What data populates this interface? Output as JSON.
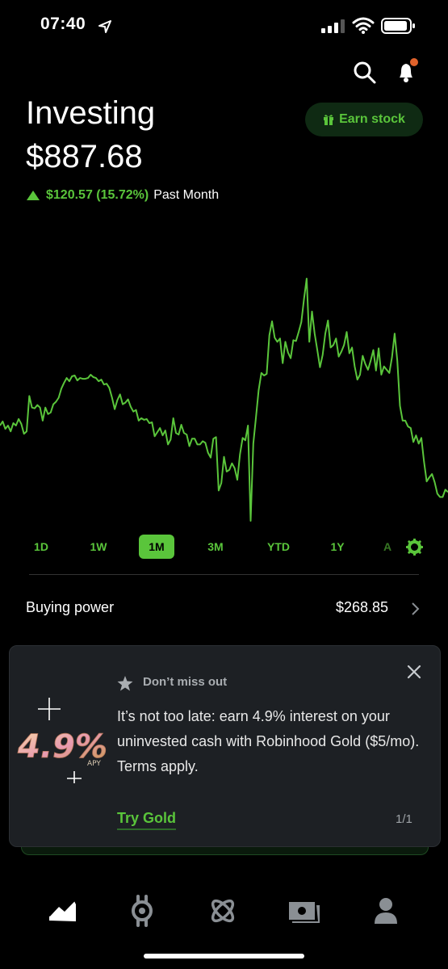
{
  "status_bar": {
    "time": "07:40"
  },
  "header": {
    "title": "Investing",
    "portfolio_value": "$887.68",
    "change_amount": "$120.57 (15.72%)",
    "change_period": "Past Month",
    "earn_stock_label": "Earn stock"
  },
  "colors": {
    "accent": "#5ac53b",
    "background": "#000000",
    "card": "#1d2024"
  },
  "chart_data": {
    "type": "line",
    "series": [
      {
        "values": [
          462,
          467,
          458,
          462,
          455,
          465,
          462,
          470,
          464,
          452,
          455,
          498,
          484,
          483,
          487,
          484,
          468,
          484,
          476,
          478,
          488,
          491,
          496,
          507,
          514,
          520,
          516,
          522,
          523,
          517,
          520,
          519,
          519,
          520,
          524,
          521,
          520,
          516,
          518,
          512,
          513,
          508,
          496,
          482,
          493,
          500,
          488,
          490,
          494,
          485,
          479,
          481,
          468,
          471,
          469,
          470,
          465,
          466,
          449,
          454,
          459,
          450,
          456,
          439,
          445,
          471,
          453,
          451,
          463,
          453,
          451,
          437,
          446,
          446,
          439,
          439,
          443,
          441,
          429,
          423,
          446,
          448,
          383,
          392,
          424,
          406,
          408,
          416,
          410,
          396,
          427,
          447,
          444,
          462,
          346,
          440,
          472,
          505,
          526,
          523,
          525,
          572,
          589,
          569,
          564,
          568,
          538,
          564,
          551,
          544,
          566,
          565,
          576,
          588,
          616,
          641,
          564,
          601,
          574,
          554,
          533,
          548,
          574,
          590,
          557,
          560,
          568,
          546,
          552,
          560,
          576,
          550,
          557,
          534,
          518,
          524,
          547,
          537,
          530,
          541,
          554,
          529,
          556,
          524,
          534,
          530,
          526,
          545,
          574,
          541,
          486,
          468,
          468,
          461,
          459,
          442,
          450,
          440,
          447,
          418,
          394,
          399,
          403,
          393,
          379,
          375,
          375,
          384,
          381
        ]
      }
    ],
    "ranges": [
      "1D",
      "1W",
      "1M",
      "3M",
      "YTD",
      "1Y",
      "A"
    ],
    "selected_range": "1M"
  },
  "buying_power": {
    "label": "Buying power",
    "value": "$268.85"
  },
  "promo": {
    "heading": "Don’t miss out",
    "body": "It’s not too late: earn 4.9% interest on your uninvested cash with Robinhood Gold ($5/mo). Terms apply.",
    "cta": "Try Gold",
    "pager": "1/1",
    "graphic_rate": "4.9%",
    "graphic_sub": "APY"
  },
  "tabs": [
    {
      "icon": "chart-icon"
    },
    {
      "icon": "crypto-icon"
    },
    {
      "icon": "atom-icon"
    },
    {
      "icon": "money-icon"
    },
    {
      "icon": "account-icon"
    }
  ]
}
